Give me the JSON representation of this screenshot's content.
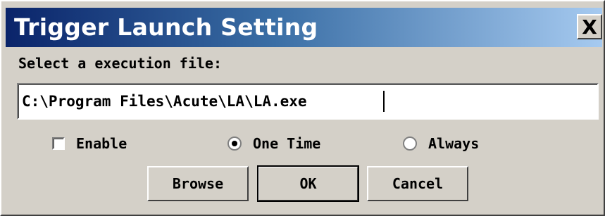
{
  "dialog": {
    "title": "Trigger Launch Setting",
    "close_label": "X",
    "prompt": "Select a execution file:",
    "file_path": "C:\\Program Files\\Acute\\LA\\LA.exe"
  },
  "options": {
    "enable": {
      "label": "Enable",
      "checked": false
    },
    "one_time": {
      "label": "One Time",
      "selected": true
    },
    "always": {
      "label": "Always",
      "selected": false
    }
  },
  "buttons": {
    "browse": "Browse",
    "ok": "OK",
    "cancel": "Cancel"
  },
  "colors": {
    "titlebar_start": "#0a246a",
    "titlebar_end": "#a6caf0",
    "face": "#d4d0c8"
  }
}
